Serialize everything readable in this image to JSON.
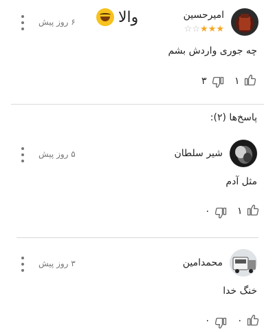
{
  "main_comment": {
    "author": "امیرحسین",
    "date": "۶ روز پیش",
    "title": "والا",
    "title_emoji": "rolling-on-floor-laughing",
    "rating": 3,
    "rating_max": 5,
    "text": "چه جوری واردش بشم",
    "likes": "۱",
    "dislikes": "۳"
  },
  "replies_label": "پاسخ‌ها (۲):",
  "replies": [
    {
      "author": "شیر سلطان",
      "date": "۵ روز پیش",
      "text": "مثل آدم",
      "likes": "۱",
      "dislikes": "۰"
    },
    {
      "author": "محمدامین",
      "date": "۳ روز پیش",
      "text": "خنگ خدا",
      "likes": "۰",
      "dislikes": "۰"
    }
  ],
  "colors": {
    "star": "#f5a623",
    "text": "#222222",
    "muted": "#777777",
    "divider": "#d9d9d9"
  }
}
